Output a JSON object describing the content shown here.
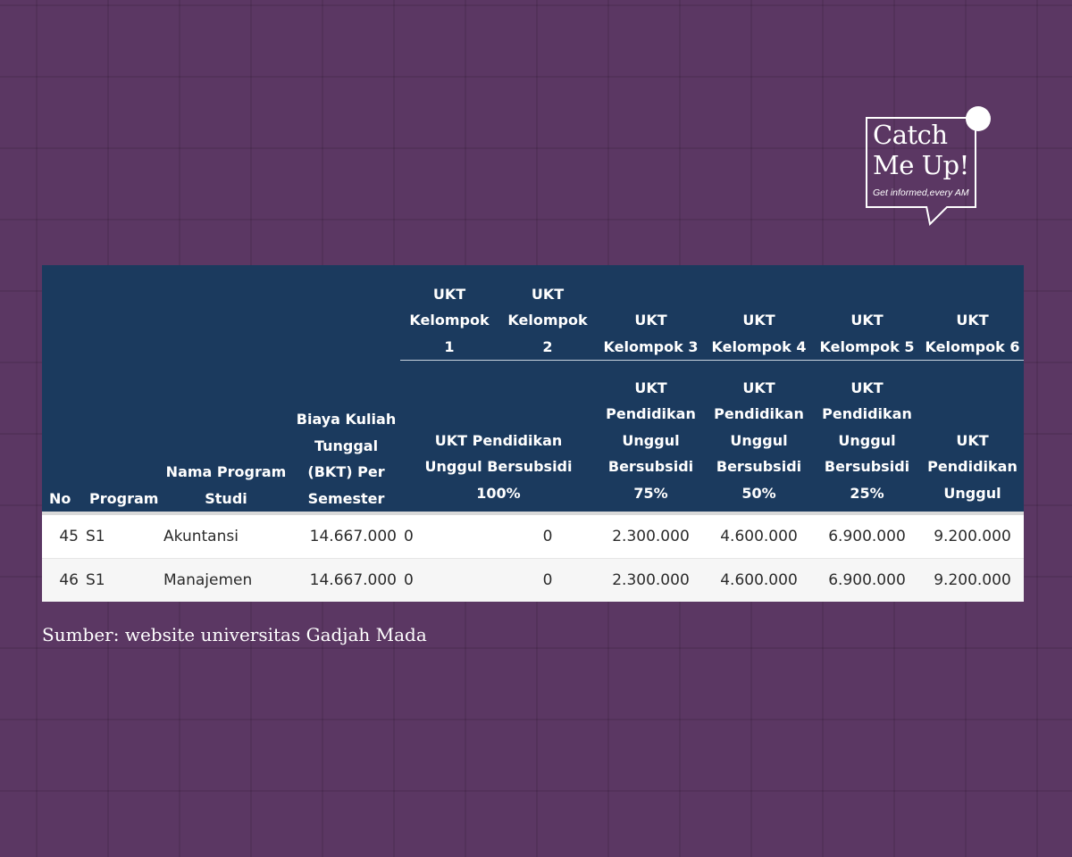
{
  "logo": {
    "line1": "Catch",
    "line2": "Me Up!",
    "tagline": "Get informed,every AM"
  },
  "table": {
    "header": {
      "no": "No",
      "program": "Program",
      "nama": "Nama Program Studi",
      "bkt": "Biaya Kuliah Tunggal (BKT) Per Semester",
      "groups": [
        "UKT Kelompok 1",
        "UKT Kelompok 2",
        "UKT Kelompok 3",
        "UKT Kelompok 4",
        "UKT Kelompok 5",
        "UKT Kelompok 6"
      ],
      "subs": [
        "UKT Pendidikan Unggul Bersubsidi 100%",
        "UKT Pendidikan Unggul Bersubsidi 75%",
        "UKT Pendidikan Unggul Bersubsidi 50%",
        "UKT Pendidikan Unggul Bersubsidi 25%",
        "UKT Pendidikan Unggul"
      ]
    },
    "rows": [
      {
        "no": "45",
        "program": "S1",
        "nama": "Akuntansi",
        "bkt": "14.667.000",
        "k1": "0",
        "k2": "0",
        "k3": "2.300.000",
        "k4": "4.600.000",
        "k5": "6.900.000",
        "k6": "9.200.000"
      },
      {
        "no": "46",
        "program": "S1",
        "nama": "Manajemen",
        "bkt": "14.667.000",
        "k1": "0",
        "k2": "0",
        "k3": "2.300.000",
        "k4": "4.600.000",
        "k5": "6.900.000",
        "k6": "9.200.000"
      }
    ]
  },
  "source": "Sumber: website universitas Gadjah Mada"
}
